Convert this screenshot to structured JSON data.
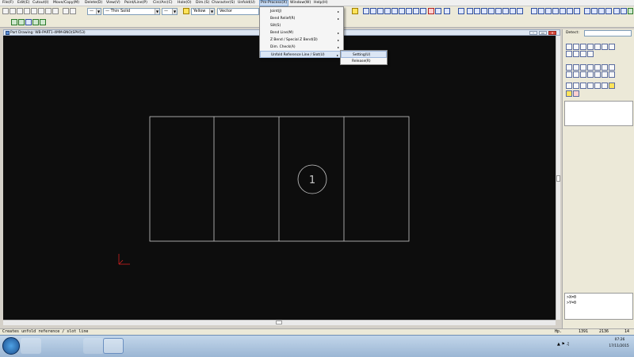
{
  "menubar": {
    "items": [
      {
        "label": "File(F)"
      },
      {
        "label": "Edit(E)"
      },
      {
        "label": "Cutout(I)"
      },
      {
        "label": "Move/Copy(M)"
      },
      {
        "label": "Delete(D)"
      },
      {
        "label": "View(V)"
      },
      {
        "label": "Point/Line(P)"
      },
      {
        "label": "Circ/Arc(C)"
      },
      {
        "label": "Hole(O)"
      },
      {
        "label": "Dim.(S)"
      },
      {
        "label": "Character(S)"
      },
      {
        "label": "Unfold(U)"
      },
      {
        "label": "Pre-Process(X)"
      },
      {
        "label": "Window(W)"
      },
      {
        "label": "Help(H)"
      }
    ]
  },
  "toolbar": {
    "line_type": "— Thin Solid",
    "line_arrow": "—",
    "color_name": "Yellow",
    "color_value": "#ffff00",
    "render_mode": "Vector"
  },
  "dropdown_menu": {
    "items": [
      {
        "label": "Joint(J)",
        "has_submenu": true
      },
      {
        "label": "Bend Relief(R)",
        "has_submenu": true
      },
      {
        "label": "Slit(S)",
        "has_submenu": false
      },
      {
        "label": "Bend Line(M)",
        "has_submenu": true
      },
      {
        "label": "Z Bend / Special Z Bend(D)",
        "has_submenu": true
      },
      {
        "label": "Dim. Check(A)",
        "has_submenu": true
      },
      {
        "label": "Unfold Reference Line / Slot(U)",
        "has_submenu": true
      }
    ],
    "submenu_arrow": "▸"
  },
  "submenu": {
    "items": [
      {
        "label": "Setting(U)"
      },
      {
        "label": "Release(R)"
      }
    ]
  },
  "document": {
    "title": "Part Drawing: WB-PART1-4MM-BNO(SPH53)",
    "controls": [
      "–",
      "▭",
      "✕"
    ]
  },
  "drawing": {
    "circle_label": "1",
    "line_color": "#c8c8c8",
    "origin_color": "#d02020",
    "background": "#0d0d0d"
  },
  "right_panel": {
    "detect_label": "Detect:",
    "detect_value": "",
    "coord_x": ">X=0",
    "coord_y": ">Y=0"
  },
  "statusbar": {
    "message": "Creates unfold reference / slot line",
    "mode": "Hp.",
    "value1": "1391",
    "value2": "2136",
    "value3": "14"
  },
  "taskbar": {
    "time": "07:26",
    "date": "17/11/2015"
  },
  "colors": {
    "menu_active": "#c7d9f1",
    "canvas_bg": "#0d0d0d",
    "taskbar": "#9bb6d4"
  }
}
